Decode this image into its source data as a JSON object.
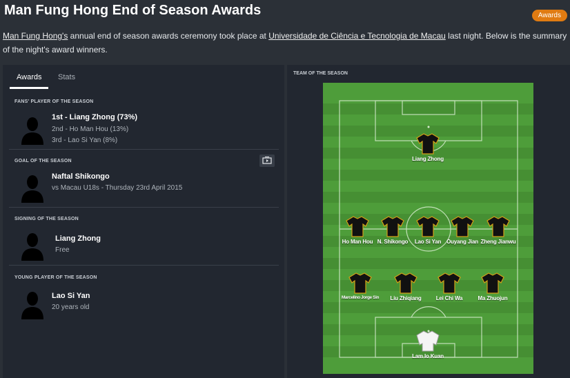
{
  "header": {
    "title": "Man Fung Hong End of Season Awards",
    "badge": "Awards"
  },
  "intro": {
    "club": "Man Fung Hong's",
    "text1": " annual end of season awards ceremony took place at ",
    "venue": "Universidade de Ciência e Tecnologia de Macau",
    "text2": " last night. Below is the summary of the night's award winners."
  },
  "tabs": [
    {
      "label": "Awards",
      "active": true
    },
    {
      "label": "Stats",
      "active": false
    }
  ],
  "awards": {
    "fans": {
      "heading": "FANS' PLAYER OF THE SEASON",
      "first": "1st - Liang Zhong (73%)",
      "second": "2nd - Ho Man Hou (13%)",
      "third": "3rd - Lao Si Yan (8%)"
    },
    "goal": {
      "heading": "GOAL OF THE SEASON",
      "player": "Naftal Shikongo",
      "detail": "vs Macau U18s - Thursday 23rd April 2015"
    },
    "signing": {
      "heading": "SIGNING OF THE SEASON",
      "player": "Liang Zhong",
      "detail": "Free"
    },
    "young": {
      "heading": "YOUNG PLAYER OF THE SEASON",
      "player": "Lao Si Yan",
      "detail": "20 years old"
    }
  },
  "team": {
    "heading": "TEAM OF THE SEASON",
    "striker": "Liang Zhong",
    "midfield": [
      "Ho Man Hou",
      "N. Shikongo",
      "Lao Si Yan",
      "Ouyang Jian",
      "Zheng Jianwu"
    ],
    "defence": [
      "Marcelino Jorge Sin",
      "Liu Zhiqiang",
      "Lei Chi Wa",
      "Ma Zhuojun"
    ],
    "goalkeeper": "Lam Io Kuan"
  },
  "colors": {
    "accent": "#e07b12",
    "pitch_light": "#4e9d3a",
    "pitch_dark": "#3f8b2d",
    "background": "#2b3037"
  }
}
